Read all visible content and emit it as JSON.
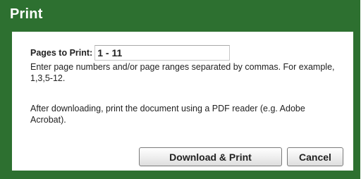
{
  "dialog": {
    "title": "Print",
    "pages_label": "Pages to Print:",
    "pages_value": "1 - 11",
    "help_text": "Enter page numbers and/or page ranges separated by commas. For example, 1,3,5-12.",
    "after_text": "After downloading, print the document using a PDF reader (e.g. Adobe Acrobat).",
    "download_label": "Download & Print",
    "cancel_label": "Cancel"
  },
  "colors": {
    "header_green": "#2d7030",
    "button_border": "#7a7a7a"
  }
}
